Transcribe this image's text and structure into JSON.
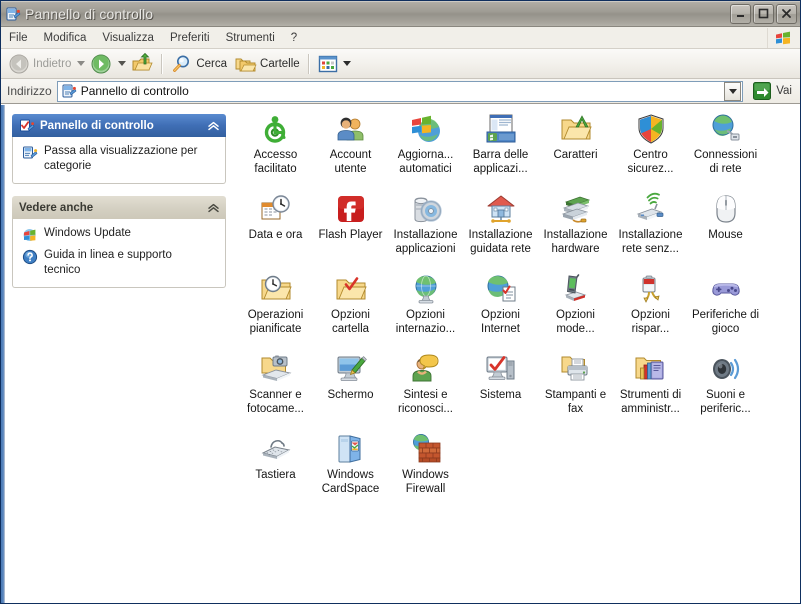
{
  "window": {
    "title": "Pannello di controllo",
    "title_icon": "control-panel-icon",
    "caption": {
      "minimize": "Riduci a icona",
      "maximize": "Ingrandisci",
      "close": "Chiudi"
    }
  },
  "menubar": {
    "items": [
      {
        "label": "File"
      },
      {
        "label": "Modifica"
      },
      {
        "label": "Visualizza"
      },
      {
        "label": "Preferiti"
      },
      {
        "label": "Strumenti"
      },
      {
        "label": "?"
      }
    ],
    "brand_icon": "windows-flag-icon"
  },
  "toolbar": {
    "back_label": "Indietro",
    "back_disabled": true,
    "forward_label": "Avanti",
    "up_label": "Cartella superiore",
    "search_label": "Cerca",
    "folders_label": "Cartelle",
    "views_label": "Visualizza"
  },
  "address": {
    "label": "Indirizzo",
    "value": "Pannello di controllo",
    "icon": "control-panel-icon",
    "go_label": "Vai"
  },
  "sidebar": {
    "panels": [
      {
        "id": "control-panel",
        "style": "blue",
        "icon": "control-panel-check-icon",
        "title": "Pannello di controllo",
        "collapse_icon": "chevron-up-icon",
        "links": [
          {
            "icon": "switch-view-icon",
            "label": "Passa alla visualizzazione per categorie"
          }
        ]
      },
      {
        "id": "see-also",
        "style": "tan",
        "icon": "",
        "title": "Vedere anche",
        "collapse_icon": "chevron-up-icon",
        "links": [
          {
            "icon": "windows-update-icon",
            "label": "Windows Update"
          },
          {
            "icon": "help-icon",
            "label": "Guida in linea e supporto tecnico"
          }
        ]
      }
    ]
  },
  "content": {
    "items": [
      {
        "icon": "accessibility-icon",
        "label": "Accesso facilitato"
      },
      {
        "icon": "user-accounts-icon",
        "label": "Account utente"
      },
      {
        "icon": "automatic-updates-icon",
        "label": "Aggiorna... automatici"
      },
      {
        "icon": "taskbar-icon",
        "label": "Barra delle applicazi..."
      },
      {
        "icon": "fonts-folder-icon",
        "label": "Caratteri"
      },
      {
        "icon": "security-center-icon",
        "label": "Centro sicurez..."
      },
      {
        "icon": "network-connections-icon",
        "label": "Connessioni di rete"
      },
      {
        "icon": "date-time-icon",
        "label": "Data e ora"
      },
      {
        "icon": "flash-player-icon",
        "label": "Flash Player"
      },
      {
        "icon": "add-remove-programs-icon",
        "label": "Installazione applicazioni"
      },
      {
        "icon": "network-setup-wizard-icon",
        "label": "Installazione guidata rete"
      },
      {
        "icon": "add-hardware-icon",
        "label": "Installazione hardware"
      },
      {
        "icon": "wireless-setup-icon",
        "label": "Installazione rete senz..."
      },
      {
        "icon": "mouse-icon",
        "label": "Mouse"
      },
      {
        "icon": "scheduled-tasks-icon",
        "label": "Operazioni pianificate"
      },
      {
        "icon": "folder-options-icon",
        "label": "Opzioni cartella"
      },
      {
        "icon": "regional-options-icon",
        "label": "Opzioni internazio..."
      },
      {
        "icon": "internet-options-icon",
        "label": "Opzioni Internet"
      },
      {
        "icon": "phone-modem-icon",
        "label": "Opzioni mode..."
      },
      {
        "icon": "power-options-icon",
        "label": "Opzioni rispar..."
      },
      {
        "icon": "game-controllers-icon",
        "label": "Periferiche di gioco"
      },
      {
        "icon": "scanners-cameras-icon",
        "label": "Scanner e fotocame..."
      },
      {
        "icon": "display-icon",
        "label": "Schermo"
      },
      {
        "icon": "speech-icon",
        "label": "Sintesi e riconosci..."
      },
      {
        "icon": "system-icon",
        "label": "Sistema"
      },
      {
        "icon": "printers-faxes-icon",
        "label": "Stampanti e fax"
      },
      {
        "icon": "admin-tools-icon",
        "label": "Strumenti di amministr..."
      },
      {
        "icon": "sounds-audio-icon",
        "label": "Suoni e periferic..."
      },
      {
        "icon": "keyboard-icon",
        "label": "Tastiera"
      },
      {
        "icon": "cardspace-icon",
        "label": "Windows CardSpace"
      },
      {
        "icon": "firewall-icon",
        "label": "Windows Firewall"
      }
    ]
  },
  "colors": {
    "title_bar_inactive": "#9f9c94",
    "panel_header_blue": "#3f6eb5",
    "panel_header_tan": "#d4d0c2",
    "window_border": "#0f2f5e",
    "content_bg": "#ffffff",
    "chrome_bg": "#f1efe9",
    "go_green": "#2f8a2f"
  }
}
